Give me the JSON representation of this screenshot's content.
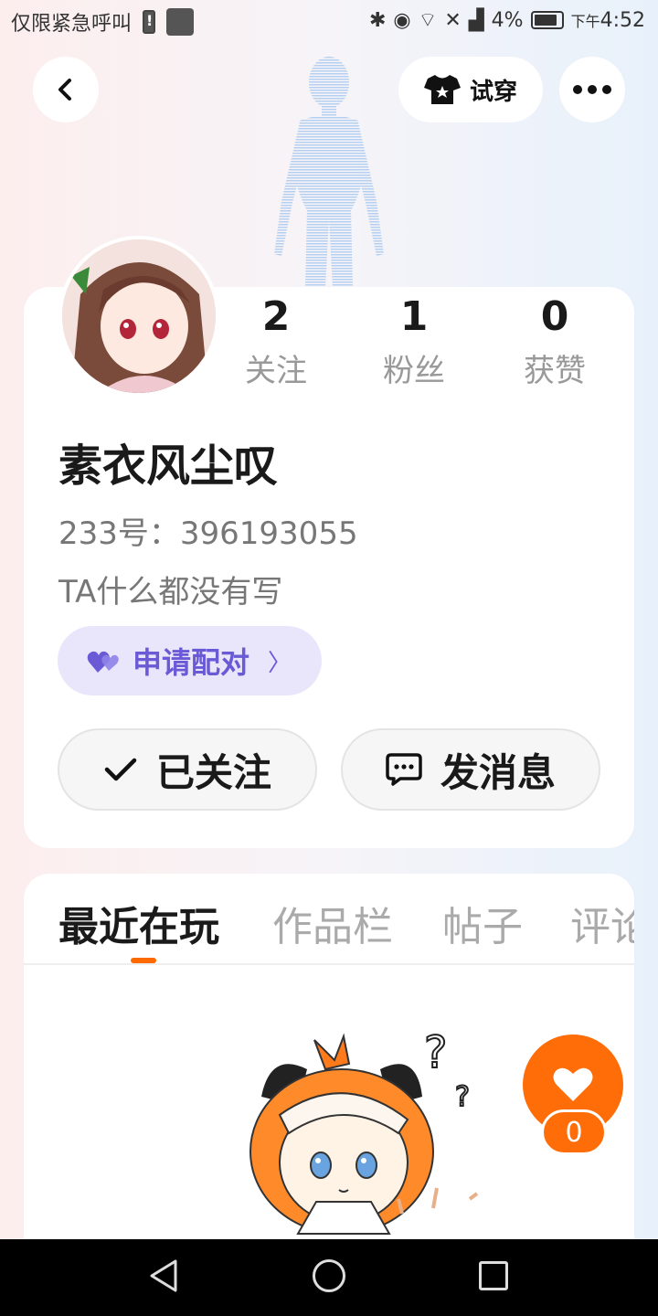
{
  "status_bar": {
    "carrier_text": "仅限紧急呼叫",
    "battery_percent": "4%",
    "time_prefix": "下午",
    "time": "4:52"
  },
  "header": {
    "tryon_label": "试穿"
  },
  "profile": {
    "stats": [
      {
        "value": "2",
        "label": "关注"
      },
      {
        "value": "1",
        "label": "粉丝"
      },
      {
        "value": "0",
        "label": "获赞"
      }
    ],
    "nickname": "素衣风尘叹",
    "user_id": "233号：396193055",
    "bio": "TA什么都没有写",
    "pair_button_label": "申请配对",
    "follow_button_label": "已关注",
    "message_button_label": "发消息"
  },
  "tabs": [
    {
      "label": "最近在玩",
      "active": true
    },
    {
      "label": "作品栏",
      "active": false
    },
    {
      "label": "帖子",
      "active": false
    },
    {
      "label": "评论",
      "active": false
    }
  ],
  "like": {
    "count": "0"
  },
  "colors": {
    "accent_orange": "#ff6d08",
    "pair_purple": "#6a5ad6",
    "pair_bg": "#e9e6fb"
  }
}
